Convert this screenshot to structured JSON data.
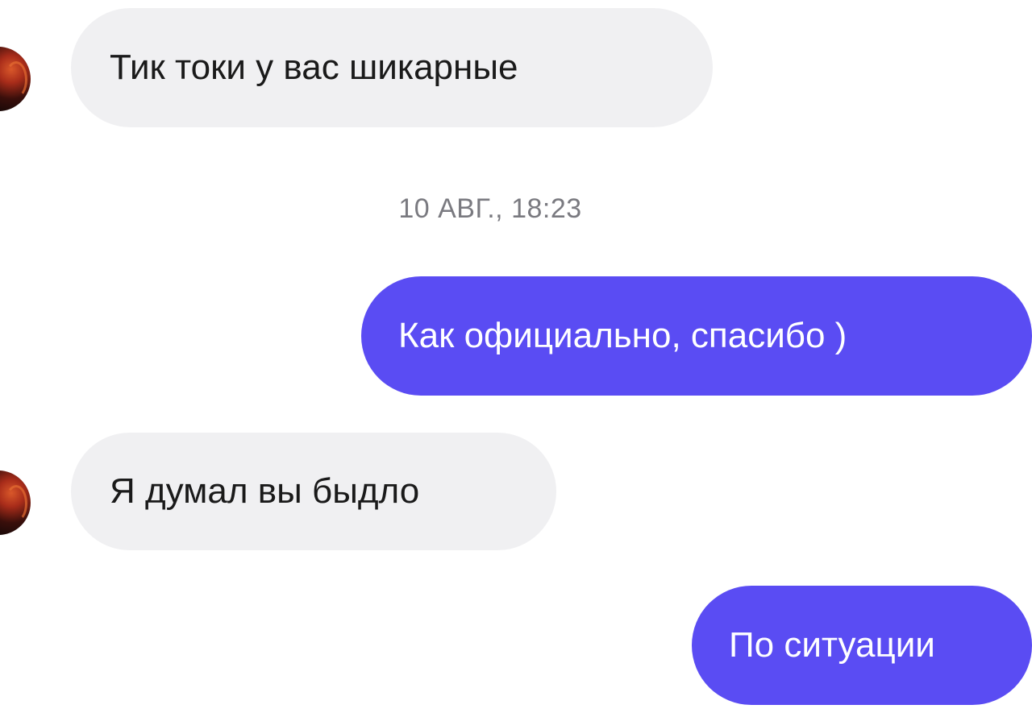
{
  "conversation": {
    "messages": [
      {
        "sender": "other",
        "text": "Тик токи у вас шикарные"
      },
      {
        "sender": "me",
        "text": "Как официально, спасибо )"
      },
      {
        "sender": "other",
        "text": "Я думал вы быдло"
      },
      {
        "sender": "me",
        "text": "По ситуации"
      }
    ],
    "timestamp": "10 АВГ., 18:23"
  },
  "colors": {
    "incoming_bubble": "#f0f0f2",
    "outgoing_bubble": "#5a4cf3",
    "timestamp_text": "#7a7a80"
  },
  "icons": {
    "avatar": "contact-avatar"
  }
}
